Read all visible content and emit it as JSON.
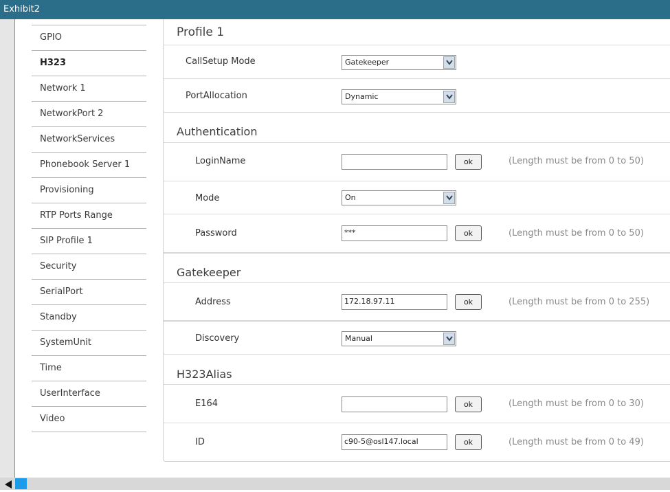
{
  "window": {
    "title": "Exhibit2"
  },
  "nav": {
    "items": [
      {
        "label": "GPIO"
      },
      {
        "label": "H323",
        "active": true
      },
      {
        "label": "Network 1"
      },
      {
        "label": "NetworkPort 2"
      },
      {
        "label": "NetworkServices"
      },
      {
        "label": "Phonebook Server 1"
      },
      {
        "label": "Provisioning"
      },
      {
        "label": "RTP Ports Range"
      },
      {
        "label": "SIP Profile 1"
      },
      {
        "label": "Security"
      },
      {
        "label": "SerialPort"
      },
      {
        "label": "Standby"
      },
      {
        "label": "SystemUnit"
      },
      {
        "label": "Time"
      },
      {
        "label": "UserInterface"
      },
      {
        "label": "Video"
      }
    ]
  },
  "panel": {
    "title": "Profile 1",
    "callsetup": {
      "label": "CallSetup Mode",
      "value": "Gatekeeper"
    },
    "portallocation": {
      "label": "PortAllocation",
      "value": "Dynamic"
    },
    "authentication": {
      "title": "Authentication",
      "loginname": {
        "label": "LoginName",
        "value": "",
        "ok": "ok",
        "hint": "(Length must be from 0 to 50)"
      },
      "mode": {
        "label": "Mode",
        "value": "On"
      },
      "password": {
        "label": "Password",
        "value": "***",
        "ok": "ok",
        "hint": "(Length must be from 0 to 50)"
      }
    },
    "gatekeeper": {
      "title": "Gatekeeper",
      "address": {
        "label": "Address",
        "value": "172.18.97.11",
        "ok": "ok",
        "hint": "(Length must be from 0 to 255)"
      },
      "discovery": {
        "label": "Discovery",
        "value": "Manual"
      }
    },
    "alias": {
      "title": "H323Alias",
      "e164": {
        "label": "E164",
        "value": "",
        "ok": "ok",
        "hint": "(Length must be from 0 to 30)"
      },
      "id": {
        "label": "ID",
        "value": "c90-5@osl147.local",
        "ok": "ok",
        "hint": "(Length must be from 0 to 49)"
      }
    }
  },
  "colors": {
    "titlebar": "#2a6e8a",
    "scroll_thumb": "#1e9be8"
  },
  "icons": {
    "select_arrow": "chevron-down-icon",
    "scroll_left": "triangle-left-icon"
  }
}
